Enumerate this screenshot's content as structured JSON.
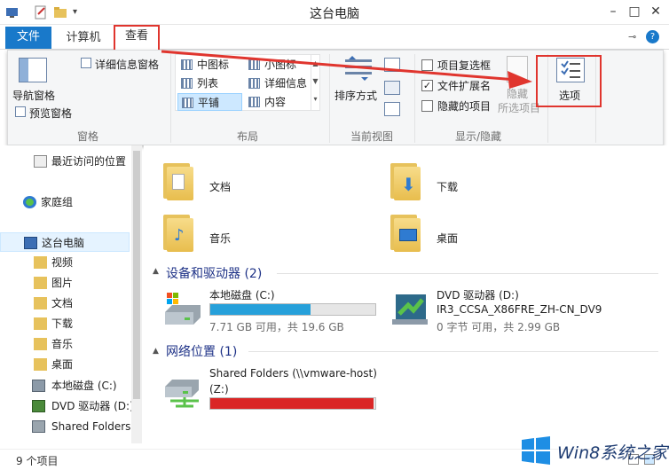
{
  "window": {
    "title": "这台电脑"
  },
  "tabs": {
    "file": "文件",
    "computer": "计算机",
    "view": "查看"
  },
  "ribbon": {
    "pane_group": {
      "nav_pane": "导航窗格",
      "preview_pane": "预览窗格",
      "details_pane": "详细信息窗格",
      "label": "窗格"
    },
    "layout_group": {
      "items": [
        "中图标",
        "小图标",
        "列表",
        "详细信息",
        "平铺",
        "内容"
      ],
      "selected": "平铺",
      "label": "布局"
    },
    "current_view_group": {
      "sort_by": "排序方式",
      "label": "当前视图"
    },
    "show_hide_group": {
      "item_checkboxes": "项目复选框",
      "file_extensions": "文件扩展名",
      "hidden_items": "隐藏的项目",
      "hide": "隐藏",
      "selected_items": "所选项目",
      "label": "显示/隐藏"
    },
    "options": "选项"
  },
  "nav": {
    "recent": "最近访问的位置",
    "homegroup": "家庭组",
    "this_pc": "这台电脑",
    "children": [
      "视频",
      "图片",
      "文档",
      "下载",
      "音乐",
      "桌面",
      "本地磁盘 (C:)",
      "DVD 驱动器 (D:)",
      "Shared Folders"
    ]
  },
  "content": {
    "folders": [
      "文档",
      "下载",
      "音乐",
      "桌面"
    ],
    "devices_header": "设备和驱动器 (2)",
    "drives": [
      {
        "name": "本地磁盘 (C:)",
        "info": "7.71 GB 可用，共 19.6 GB",
        "used_fraction": 0.61,
        "color": "#26a0da"
      },
      {
        "name": "DVD 驱动器 (D:)",
        "line2": "IR3_CCSA_X86FRE_ZH-CN_DV9",
        "info": "0 字节 可用，共 2.99 GB"
      }
    ],
    "network_header": "网络位置 (1)",
    "network": {
      "name": "Shared Folders (\\\\vmware-host)",
      "drive": "(Z:)",
      "used_fraction": 0.99,
      "color": "#da2626"
    }
  },
  "status": {
    "count": "9 个项目"
  },
  "watermark": {
    "text": "Win8系统之家"
  },
  "colors": {
    "accent": "#1979ca",
    "annotation": "#e0352e"
  }
}
